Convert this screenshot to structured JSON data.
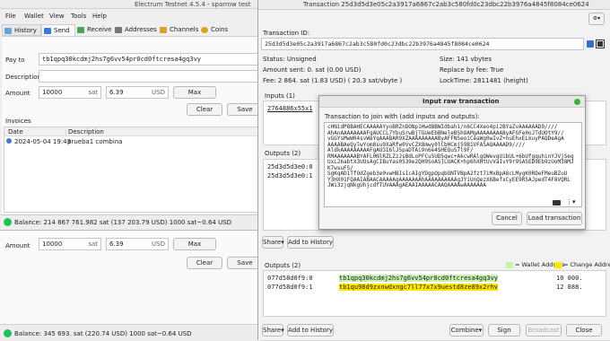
{
  "main_window": {
    "title": "Electrum Testnet 4.5.4  -  sparrow test",
    "menu": [
      "File",
      "Wallet",
      "View",
      "Tools",
      "Help"
    ],
    "tabs": [
      "History",
      "Send",
      "Receive",
      "Addresses",
      "Channels",
      "Coins"
    ],
    "pay_to_label": "Pay to",
    "pay_to_value": "tb1qpq30kcdmj2hs7g6vv54pr0cd0ftcresa4gq3vy",
    "description_label": "Description",
    "amount_label": "Amount",
    "amount_value": "10000",
    "amount_unit": "sat",
    "fiat_value": "6.39",
    "fiat_unit": "USD",
    "max_label": "Max",
    "clear_label": "Clear",
    "save_label": "Save",
    "invoices_label": "Invoices",
    "invoice_headers": [
      "Date",
      "Description"
    ],
    "invoice_rows": [
      {
        "date": "2024-05-04 19:43",
        "description": "prueba1 combina"
      }
    ],
    "balance_text": "Balance: 214 867 761.982 sat (137 203.79 USD)  1000 sat~0.64 USD",
    "accent_color": "#1a73e8"
  },
  "second_window": {
    "amount_value": "10000",
    "amount_unit": "sat",
    "fiat_value": "6.39",
    "fiat_unit": "USD",
    "max_label": "Max",
    "clear_label": "Clear",
    "save_label": "Save",
    "balance_text": "Balance: 345 693. sat (220.74 USD)  1000 sat~0.64 USD"
  },
  "tx_window": {
    "title": "Transaction 25d3d5d3e05c2a3917a6867c2ab3c580fd0c23dbc22b3976a4845f8084ce0624",
    "tx_id_label": "Transaction ID:",
    "tx_id": "25d3d5d3e05c2a3917a6867c2ab3c580fd0c23dbc22b3976a4845f8084ce0624",
    "status": "Status: Unsigned",
    "amount_sent": "Amount sent: 0. sat (0.00 USD)",
    "fee": "Fee: 2 864. sat (1.83 USD)  ( 20.3 sat/vbyte )",
    "size": "Size: 141 vbytes",
    "rbf": "Replace by fee: True",
    "locktime": "LockTime: 2811481 (height)",
    "inputs_label": "Inputs (1)",
    "input_prefix": "2764886x55x1",
    "outputs_label_top": "Outputs (2)",
    "outputs_top": [
      "25d3d5d3e0:0",
      "25d3d5d3e0:1"
    ],
    "share_label": "Share",
    "add_to_history_label": "Add to History",
    "outputs_label": "Outputs (2)",
    "legend_wallet": "= Wallet Address",
    "legend_change": "= Change Address",
    "outputs": [
      {
        "outpoint": "077d58d0f9:0",
        "address": "tb1qpq30kcdmj2hs7g6vv54pr0cd0ftcresa4gq3vy",
        "amount": "10 000."
      },
      {
        "outpoint": "077d58d0f9:1",
        "address": "tb1qu98d9zxnwdxngc7ll77x7x9uestd8ze89x2rhv",
        "amount": "12 888."
      }
    ],
    "combine_label": "Combine",
    "sign_label": "Sign",
    "broadcast_label": "Broadcast",
    "close_label": "Close"
  },
  "dialog": {
    "title": "Input raw transaction",
    "prompt": "Transaction to join with (add inputs and outputs):",
    "raw_lines": [
      "cHNidP8BAHECAAAAAYyoBRZnDONp1HwdBBWIdbah1/n6CC4Xeo4pi2BYaZvAAAAAAD9////",
      "AhAnAAAAAAAAFgAUCCL7YbuSrwBjTGUeEbBNeleBShOAMgAAAAAAAAByAFGFe0oJTdUOtY9//",
      "vGGYsMwW04svWeYqAAABAR9XZAAAAAAAAAByAFFN5eoiCeaWg0wIvZ+nuEhxELkuyPAQDeAgA",
      "AAAABAeQylwYom8su9XaRfw0VvCZX8mwy0lCbHCmj59B1VFASAQAAAAD9////",
      "AldkAAAAAAAAAFgAU3I6lJ5paDTAi9n6e4SHEQuS7l9F/",
      "RMAAAAAAABYAFL0NlRZLZzJsBdLoPFCu5UD5qwc+AkcwRAlgQWevgUibUL+6bUfgquhinYJVjSeq",
      "UxL26abtX3UOsAgCIBuYas0539e2QH9SoAS]LUACK+hp6hXHtUvVaIvY9r9SASED9Eb9zUoM38MJ",
      "K7wsuFS/",
      "SgKqAD1TfOdZgeb3e0vwHBIsIcAIgYDgpOpqbONTVBpA2fzt7iMxBpA8cLMygK0RDeFMeuBZuU",
      "Y3HX01FQAAIABAACAAAAAgAAAAAAAhAAAAAAAAAAgJYiUnQezX6BefxCyEE9R5AJpedT4F8VQRL",
      "JWi3zjqNkgUhjcdfTUVAAAgAEAAIAAAAACAAQAAAAwAAAAAAA"
    ],
    "cancel_label": "Cancel",
    "load_label": "Load transaction"
  }
}
